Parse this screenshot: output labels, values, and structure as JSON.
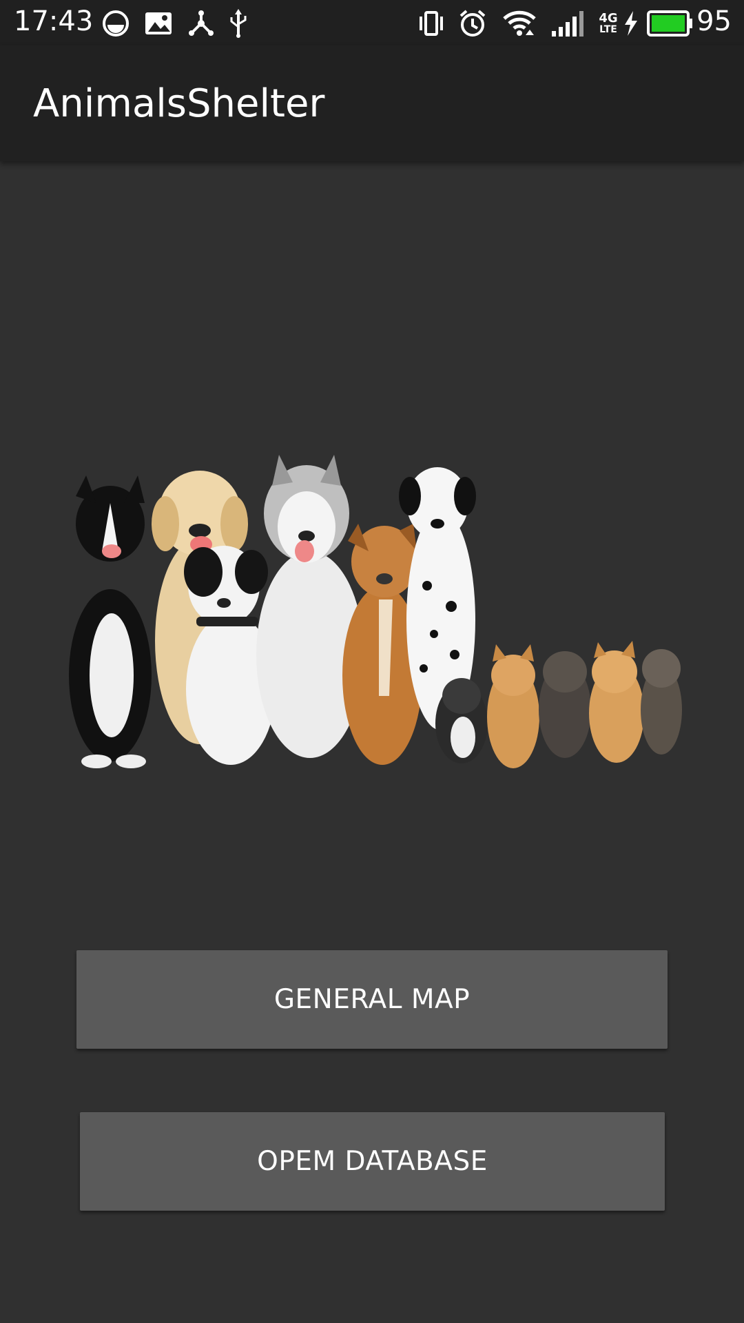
{
  "status_bar": {
    "time": "17:43",
    "battery_level": "95",
    "network_type": "4G",
    "network_sub": "LTE",
    "icons_left": [
      "moon-circle-icon",
      "image-icon",
      "share-nodes-icon",
      "usb-icon"
    ],
    "icons_right": [
      "vibrate-icon",
      "alarm-icon",
      "wifi-icon",
      "signal-icon",
      "network-4g-lte-icon",
      "charging-icon",
      "battery-icon"
    ],
    "battery_color": "#22cc22"
  },
  "app_bar": {
    "title": "AnimalsShelter"
  },
  "hero_image": {
    "description_icon": "pets-group-image"
  },
  "buttons": {
    "general_map": "GENERAL MAP",
    "open_database": "OPEM DATABASE"
  },
  "colors": {
    "background": "#303030",
    "app_bar": "#212121",
    "status_bar": "#202020",
    "button": "#5a5a5a"
  }
}
